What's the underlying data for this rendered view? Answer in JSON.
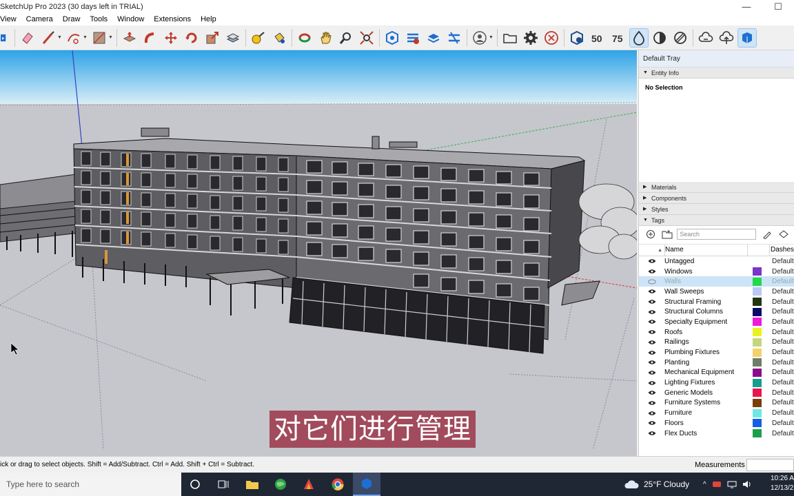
{
  "window": {
    "title": "SketchUp Pro 2023 (30 days left in TRIAL)",
    "minimize": "—",
    "maximize": "☐"
  },
  "menu": [
    "View",
    "Camera",
    "Draw",
    "Tools",
    "Window",
    "Extensions",
    "Help"
  ],
  "toolbar": {
    "icons": [
      "select-icon",
      "eraser-icon",
      "line-icon",
      "arc-icon",
      "rectangle-icon",
      "push-pull-icon",
      "follow-me-icon",
      "move-icon",
      "rotate-icon",
      "scale-icon",
      "offset-icon",
      "tape-measure-icon",
      "paint-bucket-icon",
      "orbit-icon",
      "pan-icon",
      "zoom-icon",
      "zoom-extents-icon",
      "warehouse-icon",
      "extension-warehouse-icon",
      "layout-icon",
      "trimble-connect-icon",
      "profile-icon",
      "open-icon",
      "settings-icon",
      "close-circle-icon",
      "sandbox-icon",
      "section-50-icon",
      "section-75-icon",
      "monochrome-icon",
      "shaded-icon",
      "xray-icon",
      "cloud-down-icon",
      "cloud-up-icon",
      "model-info-icon"
    ]
  },
  "tray": {
    "title": "Default Tray",
    "entity_info": {
      "header": "Entity Info",
      "selection": "No Selection"
    },
    "panels": [
      "Materials",
      "Components",
      "Styles",
      "Tags"
    ],
    "tags": {
      "search_placeholder": "Search",
      "col_name": "Name",
      "col_dashes": "Dashes",
      "rows": [
        {
          "name": "Untagged",
          "color": "",
          "dash": "Default",
          "visible": true,
          "selected": false
        },
        {
          "name": "Windows",
          "color": "#7a35c9",
          "dash": "Default",
          "visible": true,
          "selected": false
        },
        {
          "name": "Walls",
          "color": "#24d84a",
          "dash": "Default",
          "visible": false,
          "selected": true
        },
        {
          "name": "Wall Sweeps",
          "color": "#b9c8f5",
          "dash": "Default",
          "visible": true,
          "selected": false
        },
        {
          "name": "Structural Framing",
          "color": "#233610",
          "dash": "Default",
          "visible": true,
          "selected": false
        },
        {
          "name": "Structural Columns",
          "color": "#0b0b66",
          "dash": "Default",
          "visible": true,
          "selected": false
        },
        {
          "name": "Specialty Equipment",
          "color": "#ef19d8",
          "dash": "Default",
          "visible": true,
          "selected": false
        },
        {
          "name": "Roofs",
          "color": "#e9f21e",
          "dash": "Default",
          "visible": true,
          "selected": false
        },
        {
          "name": "Railings",
          "color": "#c4d67e",
          "dash": "Default",
          "visible": true,
          "selected": false
        },
        {
          "name": "Plumbing Fixtures",
          "color": "#f4d16d",
          "dash": "Default",
          "visible": true,
          "selected": false
        },
        {
          "name": "Planting",
          "color": "#6f7c68",
          "dash": "Default",
          "visible": true,
          "selected": false
        },
        {
          "name": "Mechanical Equipment",
          "color": "#8a0e8a",
          "dash": "Default",
          "visible": true,
          "selected": false
        },
        {
          "name": "Lighting Fixtures",
          "color": "#13a08d",
          "dash": "Default",
          "visible": true,
          "selected": false
        },
        {
          "name": "Generic Models",
          "color": "#e8154e",
          "dash": "Default",
          "visible": true,
          "selected": false
        },
        {
          "name": "Furniture Systems",
          "color": "#7a3e06",
          "dash": "Default",
          "visible": true,
          "selected": false
        },
        {
          "name": "Furniture",
          "color": "#6fe8e4",
          "dash": "Default",
          "visible": true,
          "selected": false
        },
        {
          "name": "Floors",
          "color": "#1360e0",
          "dash": "Default",
          "visible": true,
          "selected": false
        },
        {
          "name": "Flex Ducts",
          "color": "#1aa04a",
          "dash": "Default",
          "visible": true,
          "selected": false
        }
      ]
    }
  },
  "subtitle": "对它们进行管理",
  "status": {
    "message": "ick or drag to select objects. Shift = Add/Subtract. Ctrl = Add. Shift + Ctrl = Subtract.",
    "measurements_label": "Measurements"
  },
  "taskbar": {
    "search_placeholder": "Type here to search",
    "weather": "25°F  Cloudy",
    "time": "10:26 A",
    "date": "12/13/2"
  }
}
